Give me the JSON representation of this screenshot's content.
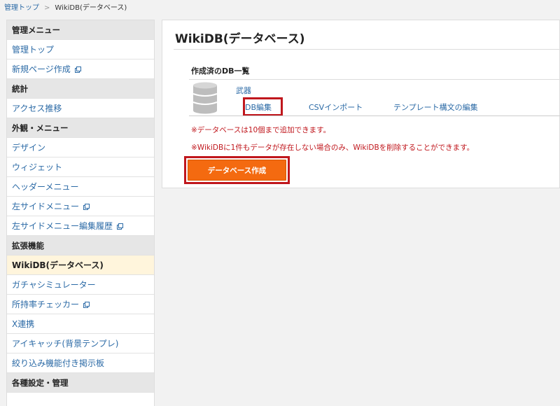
{
  "breadcrumb": {
    "home": "管理トップ",
    "separator": ">",
    "current": "WikiDB(データベース)"
  },
  "sidebar": {
    "rows": [
      {
        "type": "head",
        "label": "管理メニュー"
      },
      {
        "type": "item",
        "label": "管理トップ"
      },
      {
        "type": "item",
        "label": "新規ページ作成",
        "external": true
      },
      {
        "type": "head",
        "label": "統計"
      },
      {
        "type": "item",
        "label": "アクセス推移"
      },
      {
        "type": "head",
        "label": "外観・メニュー"
      },
      {
        "type": "item",
        "label": "デザイン"
      },
      {
        "type": "item",
        "label": "ウィジェット"
      },
      {
        "type": "item",
        "label": "ヘッダーメニュー"
      },
      {
        "type": "item",
        "label": "左サイドメニュー",
        "external": true
      },
      {
        "type": "item",
        "label": "左サイドメニュー編集履歴",
        "external": true
      },
      {
        "type": "head",
        "label": "拡張機能"
      },
      {
        "type": "item",
        "label": "WikiDB(データベース)",
        "active": true
      },
      {
        "type": "item",
        "label": "ガチャシミュレーター"
      },
      {
        "type": "item",
        "label": "所持率チェッカー",
        "external": true
      },
      {
        "type": "item",
        "label": "X連携"
      },
      {
        "type": "item",
        "label": "アイキャッチ(背景テンプレ)"
      },
      {
        "type": "item",
        "label": "絞り込み機能付き掲示板"
      },
      {
        "type": "head",
        "label": "各種設定・管理"
      }
    ]
  },
  "main": {
    "title": "WikiDB(データベース)",
    "section_title": "作成済のDB一覧",
    "database": {
      "name": "武器",
      "actions": {
        "edit": "DB編集",
        "csv_import": "CSVインポート",
        "template_edit": "テンプレート構文の編集"
      }
    },
    "notes": [
      "※データベースは10個まで追加できます。",
      "※WikiDBに1件もデータが存在しない場合のみ、WikiDBを削除することができます。"
    ],
    "create_button": "データベース作成"
  },
  "colors": {
    "link": "#2b6aa6",
    "accent_orange": "#f46a10",
    "highlight_red": "#c0171d",
    "active_row_bg": "#fff5dc",
    "section_head_bg": "#e6e6e6"
  },
  "icons": {
    "external": "external-link-icon",
    "database": "database-icon"
  }
}
